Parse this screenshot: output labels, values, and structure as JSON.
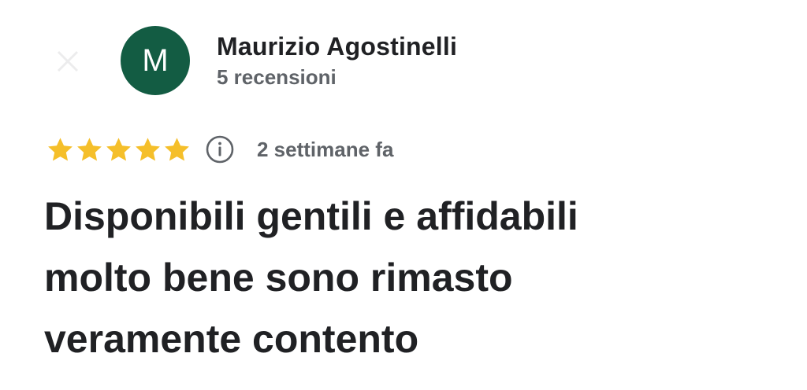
{
  "reviewer": {
    "avatar_letter": "M",
    "avatar_color": "#135c43",
    "name": "Maurizio Agostinelli",
    "review_count": "5 recensioni"
  },
  "rating": {
    "stars": 5,
    "max_stars": 5,
    "star_color": "#f5bf2a",
    "time_ago": "2 settimane fa"
  },
  "review": {
    "lines": [
      "Disponibili gentili e affidabili",
      "molto bene sono rimasto",
      "veramente contento"
    ]
  }
}
